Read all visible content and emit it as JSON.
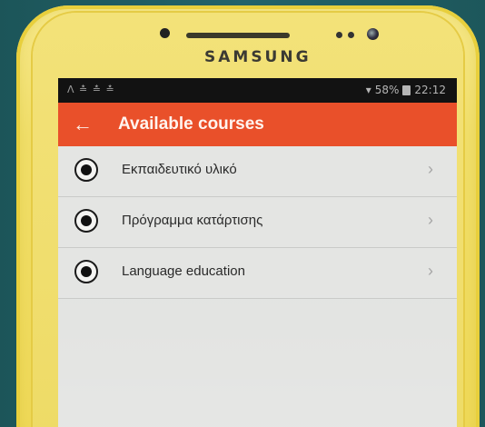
{
  "device": {
    "brand": "SAMSUNG"
  },
  "status_bar": {
    "left_icons": "ᐱ ≛ ≛ ≛",
    "signal_icon": "signal-icon",
    "battery_percent": "58%",
    "battery_icon": "battery-icon",
    "time": "22:12"
  },
  "app_bar": {
    "back_icon": "←",
    "title": "Available courses",
    "color": "#e9502a"
  },
  "courses": [
    {
      "label": "Εκπαιδευτικό υλικό",
      "icon": "radio-icon",
      "chevron": "›"
    },
    {
      "label": "Πρόγραμμα κατάρτισης",
      "icon": "radio-icon",
      "chevron": "›"
    },
    {
      "label": "Language education",
      "icon": "radio-icon",
      "chevron": "›"
    }
  ]
}
